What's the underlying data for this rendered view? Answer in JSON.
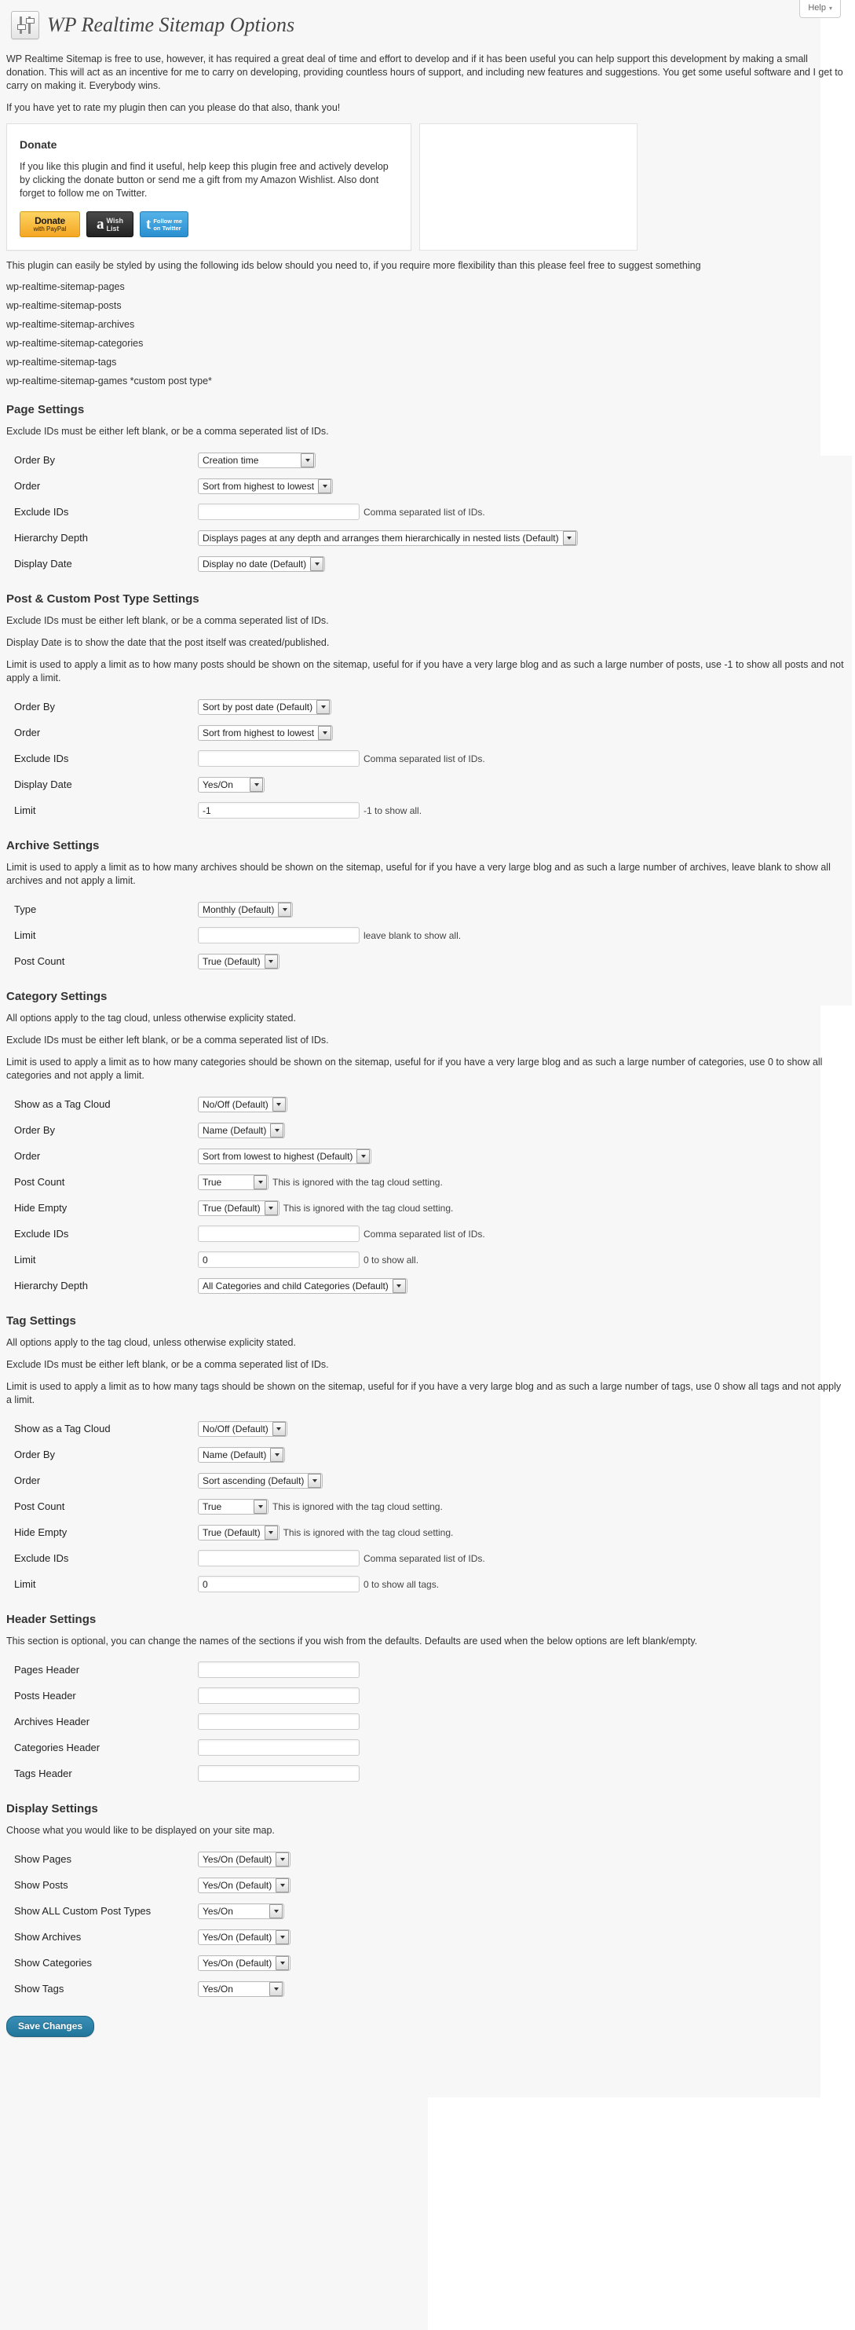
{
  "help": {
    "label": "Help",
    "caret": "▾",
    "icon": "chevron-down-icon"
  },
  "header": {
    "title": "WP Realtime Sitemap Options",
    "icon": "sliders-icon"
  },
  "intro": {
    "paragraph1": "WP Realtime Sitemap is free to use, however, it has required a great deal of time and effort to develop and if it has been useful you can help support this development by making a small donation. This will act as an incentive for me to carry on developing, providing countless hours of support, and including new features and suggestions. You get some useful software and I get to carry on making it. Everybody wins.",
    "paragraph2": "If you have yet to rate my plugin then can you please do that also, thank you!"
  },
  "donate": {
    "heading": "Donate",
    "body": "If you like this plugin and find it useful, help keep this plugin free and actively develop by clicking the donate button or send me a gift from my Amazon Wishlist. Also dont forget to follow me on Twitter.",
    "buttons": {
      "paypal": {
        "line1": "Donate",
        "line2": "with PayPal",
        "icon": "paypal-donate-button"
      },
      "amazon": {
        "mark": "a",
        "line1": "Wish",
        "line2": "List",
        "icon": "amazon-wishlist-button"
      },
      "twitter": {
        "mark": "t",
        "line1": "Follow me",
        "line2": "on Twitter",
        "icon": "twitter-follow-button"
      }
    }
  },
  "styling": {
    "note": "This plugin can easily be styled by using the following ids below should you need to, if you require more flexibility than this please feel free to suggest something",
    "ids": [
      "wp-realtime-sitemap-pages",
      "wp-realtime-sitemap-posts",
      "wp-realtime-sitemap-archives",
      "wp-realtime-sitemap-categories",
      "wp-realtime-sitemap-tags",
      "wp-realtime-sitemap-games *custom post type*"
    ]
  },
  "page_settings": {
    "heading": "Page Settings",
    "notes": [
      "Exclude IDs must be either left blank, or be a comma seperated list of IDs."
    ],
    "rows": [
      {
        "label": "Order By",
        "type": "select",
        "value": "Creation time",
        "width": 120,
        "hint": ""
      },
      {
        "label": "Order",
        "type": "select",
        "value": "Sort from highest to lowest",
        "width": 0,
        "hint": ""
      },
      {
        "label": "Exclude IDs",
        "type": "text",
        "value": "",
        "hint": "Comma separated list of IDs."
      },
      {
        "label": "Hierarchy Depth",
        "type": "select",
        "value": "Displays pages at any depth and arranges them hierarchically in nested lists (Default)",
        "width": 0,
        "hint": ""
      },
      {
        "label": "Display Date",
        "type": "select",
        "value": "Display no date (Default)",
        "width": 0,
        "hint": ""
      }
    ]
  },
  "post_settings": {
    "heading": "Post & Custom Post Type Settings",
    "notes": [
      "Exclude IDs must be either left blank, or be a comma seperated list of IDs.",
      "Display Date is to show the date that the post itself was created/published.",
      "Limit is used to apply a limit as to how many posts should be shown on the sitemap, useful for if you have a very large blog and as such a large number of posts, use -1 to show all posts and not apply a limit."
    ],
    "rows": [
      {
        "label": "Order By",
        "type": "select",
        "value": "Sort by post date (Default)",
        "hint": ""
      },
      {
        "label": "Order",
        "type": "select",
        "value": "Sort from highest to lowest",
        "hint": ""
      },
      {
        "label": "Exclude IDs",
        "type": "text",
        "value": "",
        "hint": "Comma separated list of IDs."
      },
      {
        "label": "Display Date",
        "type": "select",
        "value": "Yes/On",
        "width": 55,
        "hint": ""
      },
      {
        "label": "Limit",
        "type": "text",
        "value": "-1",
        "hint": "-1 to show all."
      }
    ]
  },
  "archive_settings": {
    "heading": "Archive Settings",
    "notes": [
      "Limit is used to apply a limit as to how many archives should be shown on the sitemap, useful for if you have a very large blog and as such a large number of archives, leave blank to show all archives and not apply a limit."
    ],
    "rows": [
      {
        "label": "Type",
        "type": "select",
        "value": "Monthly (Default)",
        "hint": ""
      },
      {
        "label": "Limit",
        "type": "text",
        "value": "",
        "hint": "leave blank to show all."
      },
      {
        "label": "Post Count",
        "type": "select",
        "value": "True (Default)",
        "hint": ""
      }
    ]
  },
  "category_settings": {
    "heading": "Category Settings",
    "notes": [
      "All options apply to the tag cloud, unless otherwise explicity stated.",
      "Exclude IDs must be either left blank, or be a comma seperated list of IDs.",
      "Limit is used to apply a limit as to how many categories should be shown on the sitemap, useful for if you have a very large blog and as such a large number of categories, use 0 to show all categories and not apply a limit."
    ],
    "rows": [
      {
        "label": "Show as a Tag Cloud",
        "type": "select",
        "value": "No/Off (Default)",
        "hint": ""
      },
      {
        "label": "Order By",
        "type": "select",
        "value": "Name (Default)",
        "hint": ""
      },
      {
        "label": "Order",
        "type": "select",
        "value": "Sort from lowest to highest (Default)",
        "hint": ""
      },
      {
        "label": "Post Count",
        "type": "select",
        "value": "True",
        "width": 60,
        "hint": "This is ignored with the tag cloud setting."
      },
      {
        "label": "Hide Empty",
        "type": "select",
        "value": "True (Default)",
        "hint": "This is ignored with the tag cloud setting."
      },
      {
        "label": "Exclude IDs",
        "type": "text",
        "value": "",
        "hint": "Comma separated list of IDs."
      },
      {
        "label": "Limit",
        "type": "text",
        "value": "0",
        "hint": "0 to show all."
      },
      {
        "label": "Hierarchy Depth",
        "type": "select",
        "value": "All Categories and child Categories (Default)",
        "width": 180,
        "hint": ""
      }
    ]
  },
  "tag_settings": {
    "heading": "Tag Settings",
    "notes": [
      "All options apply to the tag cloud, unless otherwise explicity stated.",
      "Exclude IDs must be either left blank, or be a comma seperated list of IDs.",
      "Limit is used to apply a limit as to how many tags should be shown on the sitemap, useful for if you have a very large blog and as such a large number of tags, use 0 show all tags and not apply a limit."
    ],
    "rows": [
      {
        "label": "Show as a Tag Cloud",
        "type": "select",
        "value": "No/Off (Default)",
        "hint": ""
      },
      {
        "label": "Order By",
        "type": "select",
        "value": "Name (Default)",
        "hint": ""
      },
      {
        "label": "Order",
        "type": "select",
        "value": "Sort ascending (Default)",
        "hint": ""
      },
      {
        "label": "Post Count",
        "type": "select",
        "value": "True",
        "width": 60,
        "hint": "This is ignored with the tag cloud setting."
      },
      {
        "label": "Hide Empty",
        "type": "select",
        "value": "True (Default)",
        "hint": "This is ignored with the tag cloud setting."
      },
      {
        "label": "Exclude IDs",
        "type": "text",
        "value": "",
        "hint": "Comma separated list of IDs."
      },
      {
        "label": "Limit",
        "type": "text",
        "value": "0",
        "hint": "0 to show all tags."
      }
    ]
  },
  "header_settings": {
    "heading": "Header Settings",
    "notes": [
      "This section is optional, you can change the names of the sections if you wish from the defaults. Defaults are used when the below options are left blank/empty."
    ],
    "rows": [
      {
        "label": "Pages Header",
        "type": "text",
        "value": "",
        "hint": ""
      },
      {
        "label": "Posts Header",
        "type": "text",
        "value": "",
        "hint": ""
      },
      {
        "label": "Archives Header",
        "type": "text",
        "value": "",
        "hint": ""
      },
      {
        "label": "Categories Header",
        "type": "text",
        "value": "",
        "hint": ""
      },
      {
        "label": "Tags Header",
        "type": "text",
        "value": "",
        "hint": ""
      }
    ]
  },
  "display_settings": {
    "heading": "Display Settings",
    "notes": [
      "Choose what you would like to be displayed on your site map."
    ],
    "rows": [
      {
        "label": "Show Pages",
        "type": "select",
        "value": "Yes/On (Default)",
        "hint": ""
      },
      {
        "label": "Show Posts",
        "type": "select",
        "value": "Yes/On (Default)",
        "hint": ""
      },
      {
        "label": "Show ALL Custom Post Types",
        "type": "select",
        "value": "Yes/On",
        "width": 80,
        "hint": ""
      },
      {
        "label": "Show Archives",
        "type": "select",
        "value": "Yes/On (Default)",
        "hint": ""
      },
      {
        "label": "Show Categories",
        "type": "select",
        "value": "Yes/On (Default)",
        "hint": ""
      },
      {
        "label": "Show Tags",
        "type": "select",
        "value": "Yes/On",
        "width": 80,
        "hint": ""
      }
    ]
  },
  "save": {
    "label": "Save Changes"
  },
  "colors": {
    "accent": "#21759b",
    "page_bg": "#f7f7f7",
    "paypal": "#f5a623",
    "amazon": "#222222",
    "twitter": "#2a8fd0"
  }
}
